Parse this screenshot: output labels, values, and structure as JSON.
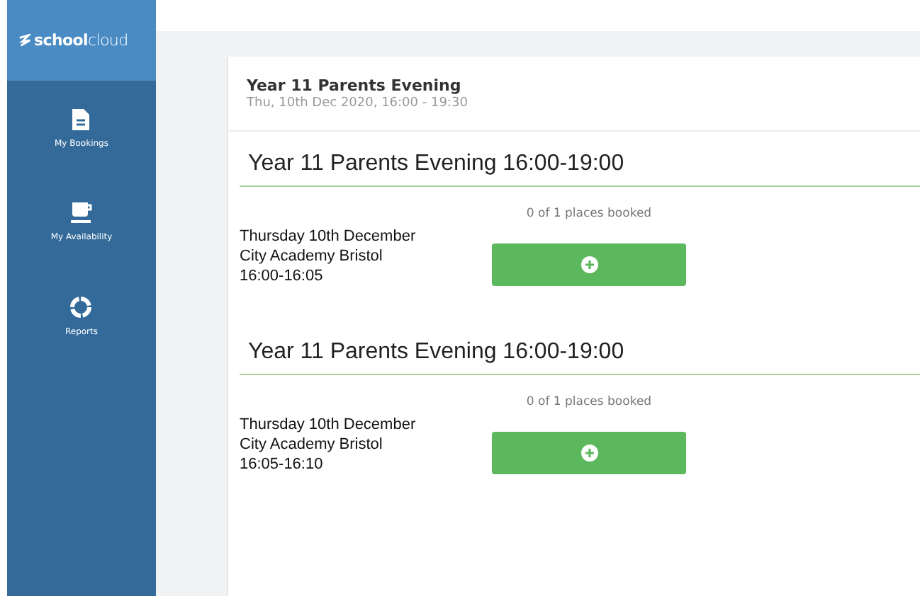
{
  "sidebar": {
    "brand": "**school**cloud",
    "items": [
      {
        "kind": "document",
        "label": "My Bookings"
      },
      {
        "kind": "cup",
        "label": "My Availability"
      },
      {
        "kind": "ring",
        "label": "Reports"
      }
    ]
  },
  "event": {
    "title": "Year 11 Parents Evening",
    "subtitle": "Thu, 10th Dec 2020, 16:00 - 19:30"
  },
  "slots": [
    {
      "heading": "Year 11 Parents Evening 16:00-19:00",
      "date": "Thursday 10th December",
      "location": "City Academy Bristol",
      "time": "16:00-16:05",
      "places": "0 of 1 places booked"
    },
    {
      "heading": "Year 11 Parents Evening 16:00-19:00",
      "date": "Thursday 10th December",
      "location": "City Academy Bristol",
      "time": "16:05-16:10",
      "places": "0 of 1 places booked"
    }
  ]
}
